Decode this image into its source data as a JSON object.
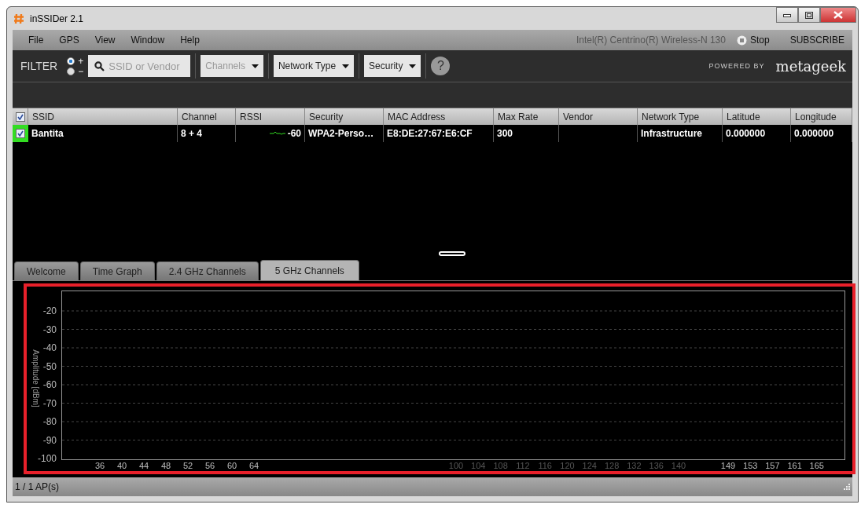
{
  "window": {
    "title": "inSSIDer 2.1"
  },
  "menu": [
    {
      "label": "File"
    },
    {
      "label": "GPS"
    },
    {
      "label": "View"
    },
    {
      "label": "Window"
    },
    {
      "label": "Help"
    }
  ],
  "adapter": "Intel(R) Centrino(R) Wireless-N 130",
  "stop_button": "Stop",
  "subscribe": "SUBSCRIBE",
  "filter": {
    "label": "FILTER",
    "modes": [
      {
        "label": "+",
        "selected": true
      },
      {
        "label": "−",
        "selected": false
      }
    ],
    "search": {
      "placeholder": "SSID or Vendor"
    },
    "dropdowns": [
      {
        "label": "Channels",
        "disabled": true
      },
      {
        "label": "Network Type",
        "disabled": false
      },
      {
        "label": "Security",
        "disabled": false
      }
    ],
    "help": "?"
  },
  "brand": {
    "prefix": "POWERED BY",
    "name": "metageek"
  },
  "table": {
    "all_checked": true,
    "columns": [
      "SSID",
      "Channel",
      "RSSI",
      "Security",
      "MAC Address",
      "Max Rate",
      "Vendor",
      "Network Type",
      "Latitude",
      "Longitude"
    ],
    "rows": [
      {
        "checked": true,
        "color": "#33dd22",
        "ssid": "Bantita",
        "channel": "8 + 4",
        "rssi": "-60",
        "security": "WPA2-Perso…",
        "mac": "E8:DE:27:67:E6:CF",
        "max_rate": "300",
        "vendor": "",
        "network_type": "Infrastructure",
        "latitude": "0.000000",
        "longitude": "0.000000"
      }
    ]
  },
  "tabs": [
    {
      "label": "Welcome",
      "selected": false
    },
    {
      "label": "Time Graph",
      "selected": false
    },
    {
      "label": "2.4 GHz Channels",
      "selected": false
    },
    {
      "label": "5 GHz Channels",
      "selected": true
    }
  ],
  "graph": {
    "highlighted": true,
    "ylabel": "Amplitude [dBm]",
    "yticks": [
      "-20",
      "-30",
      "-40",
      "-50",
      "-60",
      "-70",
      "-80",
      "-90",
      "-100"
    ],
    "channels": [
      {
        "label": "36",
        "dimmed": false
      },
      {
        "label": "40",
        "dimmed": false
      },
      {
        "label": "44",
        "dimmed": false
      },
      {
        "label": "48",
        "dimmed": false
      },
      {
        "label": "52",
        "dimmed": false
      },
      {
        "label": "56",
        "dimmed": false
      },
      {
        "label": "60",
        "dimmed": false
      },
      {
        "label": "64",
        "dimmed": false
      },
      {
        "label": "100",
        "dimmed": true
      },
      {
        "label": "104",
        "dimmed": true
      },
      {
        "label": "108",
        "dimmed": true
      },
      {
        "label": "112",
        "dimmed": true
      },
      {
        "label": "116",
        "dimmed": true
      },
      {
        "label": "120",
        "dimmed": true
      },
      {
        "label": "124",
        "dimmed": true
      },
      {
        "label": "128",
        "dimmed": true
      },
      {
        "label": "132",
        "dimmed": true
      },
      {
        "label": "136",
        "dimmed": true
      },
      {
        "label": "140",
        "dimmed": true
      },
      {
        "label": "149",
        "dimmed": false
      },
      {
        "label": "153",
        "dimmed": false
      },
      {
        "label": "157",
        "dimmed": false
      },
      {
        "label": "161",
        "dimmed": false
      },
      {
        "label": "165",
        "dimmed": false
      }
    ]
  },
  "status_bar": {
    "text": "1 / 1 AP(s)"
  }
}
